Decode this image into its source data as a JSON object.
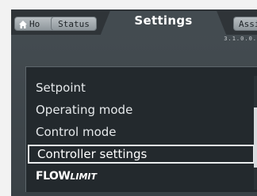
{
  "tabs": {
    "home_label": "Ho",
    "status_label": "Status",
    "assist_label": "Assi"
  },
  "header": {
    "title": "Settings",
    "version": "3.1.0.0."
  },
  "menu": {
    "items": [
      {
        "label": "Setpoint"
      },
      {
        "label": "Operating mode"
      },
      {
        "label": "Control mode"
      },
      {
        "label": "Controller settings"
      },
      {
        "label_main": "FLOW",
        "label_suffix": "LIMIT"
      }
    ],
    "selected_index": 3
  },
  "colors": {
    "screen_background": "#3f474c",
    "selection_border": "#e9ecee",
    "text": "#e5e8ea"
  },
  "icons": {
    "home": "home-icon"
  }
}
